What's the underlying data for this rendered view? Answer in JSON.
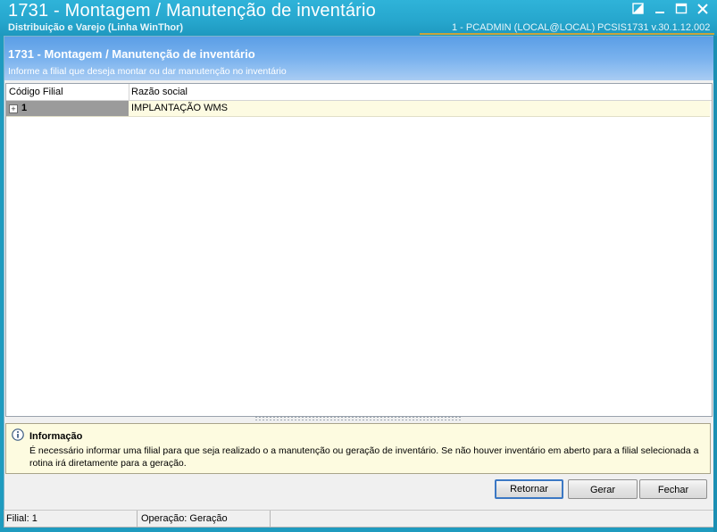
{
  "window": {
    "title": "1731 - Montagem / Manutenção de inventário",
    "subtitle": "Distribuição e Varejo (Linha WinThor)",
    "user_info": "1 - PCADMIN (LOCAL@LOCAL)",
    "system_info": "PCSIS1731  v.30.1.12.002",
    "controls": [
      "restore-alt-icon",
      "minimize-icon",
      "maximize-icon",
      "close-icon"
    ]
  },
  "header": {
    "title": "1731 - Montagem / Manutenção de inventário",
    "description": "Informe a filial que deseja montar ou dar manutenção no inventário"
  },
  "grid": {
    "columns": [
      "Código Filial",
      "Razão social"
    ],
    "rows": [
      {
        "codigo": "1",
        "razao": "IMPLANTAÇÃO WMS",
        "expander": "+"
      }
    ]
  },
  "info": {
    "icon": "info-icon",
    "title": "Informação",
    "text": "É necessário informar uma filial para que seja realizado o a manutenção ou geração de inventário. Se não houver inventário em aberto para a filial selecionada a rotina irá diretamente para a geração."
  },
  "buttons": {
    "retornar": "Retornar",
    "gerar": "Gerar",
    "fechar": "Fechar"
  },
  "status": {
    "filial": "Filial: 1",
    "operacao": "Operação: Geração"
  },
  "colors": {
    "titlebar": "#26a6cd",
    "header_gradient_top": "#5b9ee6",
    "selected_row": "#fdfbe2",
    "info_bg": "#fdfbe0",
    "accent_line": "#c9a43c"
  }
}
